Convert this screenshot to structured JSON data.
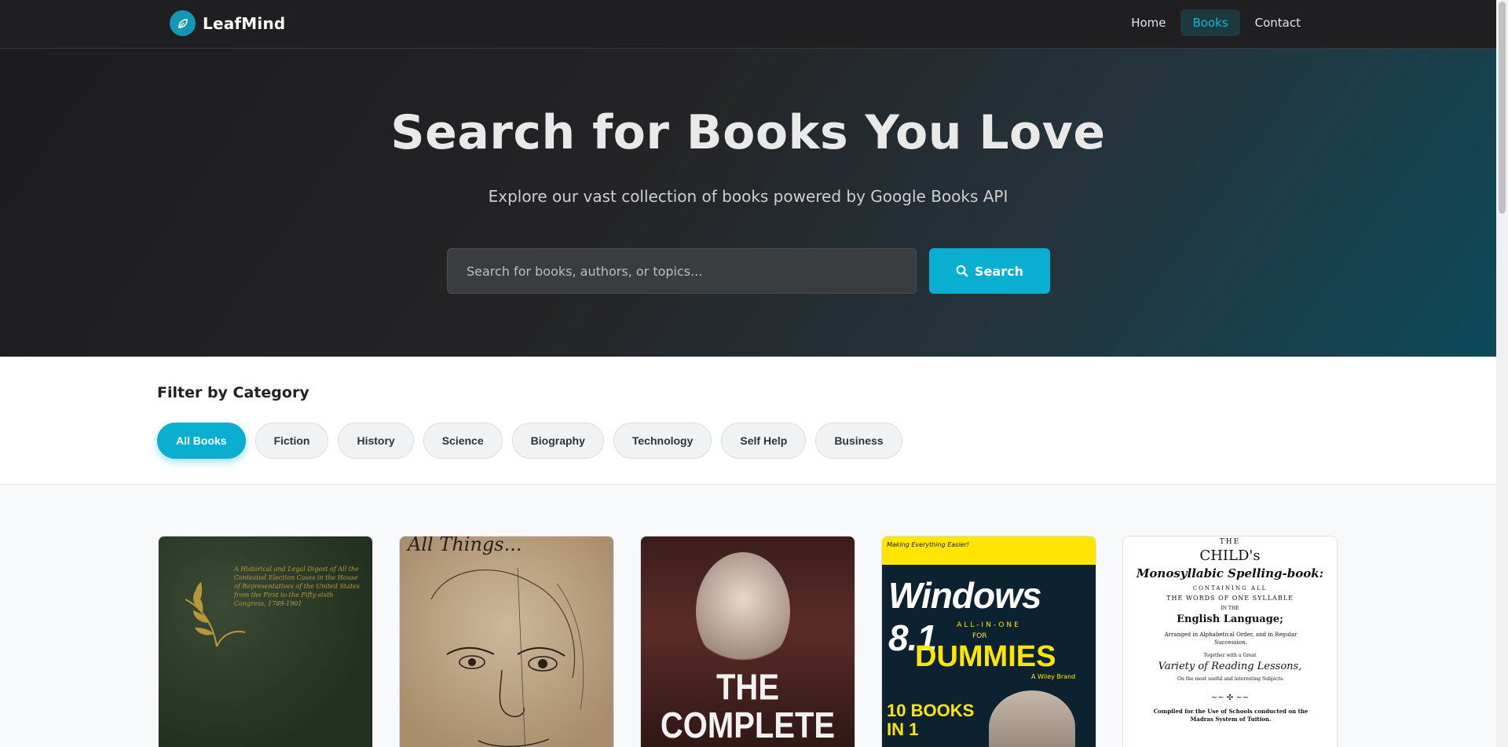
{
  "navbar": {
    "brand": "LeafMind",
    "links": [
      {
        "label": "Home",
        "active": false
      },
      {
        "label": "Books",
        "active": true
      },
      {
        "label": "Contact",
        "active": false
      }
    ]
  },
  "hero": {
    "title": "Search for Books You Love",
    "subtitle": "Explore our vast collection of books powered by Google Books API",
    "search": {
      "placeholder": "Search for books, authors, or topics...",
      "value": "",
      "button_label": "Search"
    }
  },
  "filters": {
    "title": "Filter by Category",
    "categories": [
      {
        "label": "All Books",
        "active": true
      },
      {
        "label": "Fiction",
        "active": false
      },
      {
        "label": "History",
        "active": false
      },
      {
        "label": "Science",
        "active": false
      },
      {
        "label": "Biography",
        "active": false
      },
      {
        "label": "Technology",
        "active": false
      },
      {
        "label": "Self Help",
        "active": false
      },
      {
        "label": "Business",
        "active": false
      }
    ]
  },
  "books": [
    {
      "cover_text": "A Historical and Legal Digest of All the Contested Election Cases in the House of Representatives of the United States from the First to the Fifty-sixth Congress, 1789-1901"
    },
    {
      "cover_text": "All Things..."
    },
    {
      "cover_text": "THE COMPLETE PROVINCIAL"
    },
    {
      "cover_top": "Making Everything Easier!",
      "cover_title": "Windows 8.1",
      "cover_allin": "ALL-IN-ONE",
      "cover_for": "FOR",
      "cover_brand": "DUMMIES",
      "cover_publisher": "A Wiley Brand",
      "cover_books": "10 BOOKS IN 1"
    },
    {
      "lines": [
        "THE",
        "CHILD's",
        "Monosyllabic Spelling-book:",
        "CONTAINING ALL",
        "THE WORDS OF ONE SYLLABLE",
        "IN THE",
        "English Language;",
        "Arranged in Alphabetical Order, and in Regular Succession.",
        "Together with a Great",
        "Variety of Reading Lessons,",
        "On the most useful and interesting Subjects.",
        "Compiled for the Use of Schools conducted on the Madras System of Tuition."
      ]
    }
  ],
  "colors": {
    "accent": "#0aaed0",
    "nav_bg": "#1f1f21",
    "active_link": "#19b7d6"
  }
}
